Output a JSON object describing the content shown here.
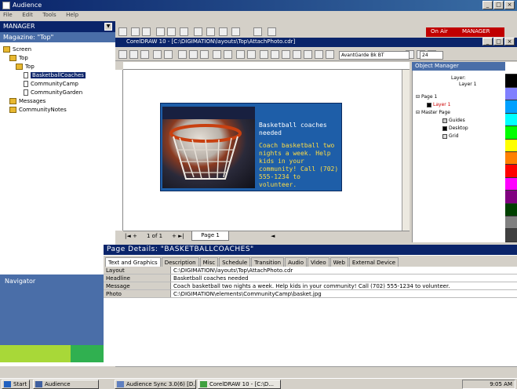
{
  "window": {
    "title": "Audience",
    "menu": [
      "File",
      "Edit",
      "Tools",
      "Help"
    ]
  },
  "left_panel": {
    "header": "MANAGER",
    "magazine_label": "Magazine: \"Top\"",
    "tree": [
      {
        "label": "Screen",
        "level": 0
      },
      {
        "label": "Top",
        "level": 1
      },
      {
        "label": "Top",
        "level": 2
      },
      {
        "label": "BasketballCoaches",
        "level": 3,
        "selected": true
      },
      {
        "label": "CommunityCamp",
        "level": 3
      },
      {
        "label": "CommunityGarden",
        "level": 3
      },
      {
        "label": "Messages",
        "level": 1
      },
      {
        "label": "CommunityNotes",
        "level": 1
      }
    ],
    "navigator_label": "Navigator"
  },
  "on_air": {
    "label": "On Air",
    "manager": "MANAGER"
  },
  "corel": {
    "title": "CorelDRAW 10 - [C:\\DIGIMATION\\layouts\\Top\\AttachPhoto.cdr]",
    "font": "AvantGarde Bk BT",
    "size": "24",
    "page_nav": "1 of 1",
    "page_tab": "Page 1"
  },
  "card": {
    "headline": "Basketball coaches needed",
    "body": "Coach basketball two nights a week. Help kids in your community! Call (702) 555-1234 to volunteer."
  },
  "object_manager": {
    "title": "Object Manager",
    "layer_label": "Layer:",
    "layer_value": "Layer 1",
    "items": [
      {
        "label": "Page 1",
        "level": 0
      },
      {
        "label": "Layer 1",
        "level": 1,
        "color": "#cc0000"
      },
      {
        "label": "Master Page",
        "level": 0
      },
      {
        "label": "Guides",
        "level": 1,
        "color": "#000000"
      },
      {
        "label": "Desktop",
        "level": 1,
        "color": "#000000"
      },
      {
        "label": "Grid",
        "level": 1,
        "color": "#aaaaaa"
      }
    ]
  },
  "palette": [
    "#ffffff",
    "#000000",
    "#8080ff",
    "#00a0ff",
    "#00ffff",
    "#00ff00",
    "#ffff00",
    "#ff8000",
    "#ff0000",
    "#ff00ff",
    "#800080",
    "#004000",
    "#808080",
    "#404040"
  ],
  "page_details": {
    "title": "Page Details: \"BASKETBALLCOACHES\"",
    "tabs": [
      "Text and Graphics",
      "Description",
      "Misc",
      "Schedule",
      "Transition",
      "Audio",
      "Video",
      "Web",
      "External Device"
    ],
    "rows": [
      {
        "key": "Layout",
        "value": "C:\\DIGIMATION\\layouts\\Top\\AttachPhoto.cdr"
      },
      {
        "key": "Headline",
        "value": "Basketball coaches needed"
      },
      {
        "key": "Message",
        "value": "Coach basketball two nights a week. Help kids in your community! Call (702) 555-1234 to volunteer."
      },
      {
        "key": "Photo",
        "value": "C:\\DIGIMATION\\elements\\CommunityCamp\\basket.jpg"
      }
    ]
  },
  "taskbar": {
    "start": "Start",
    "buttons": [
      "Audience",
      "Audience Sync 3.0(6) [D...",
      "CorelDRAW 10 - [C:\\D..."
    ],
    "time": "9:05 AM"
  }
}
